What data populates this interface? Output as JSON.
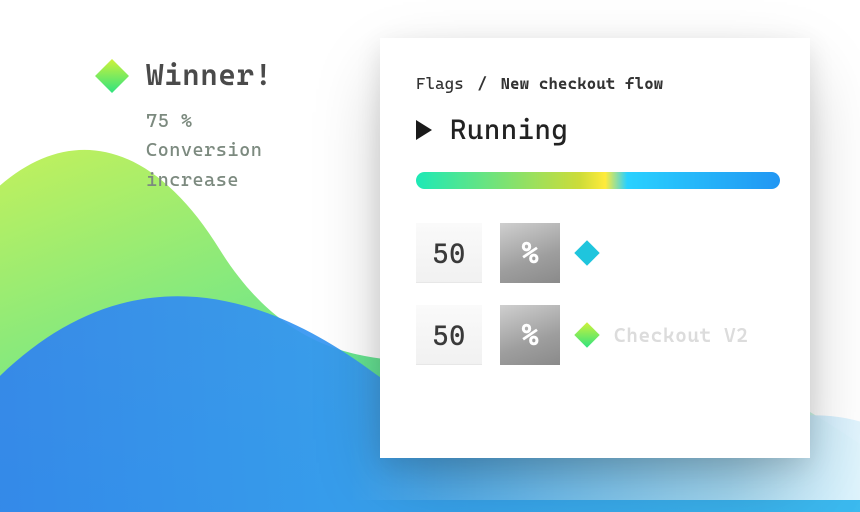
{
  "summary": {
    "title": "Winner!",
    "stat_line": "75 %",
    "metric_line1": "Conversion",
    "metric_line2": "increase"
  },
  "card": {
    "breadcrumb_root": "Flags",
    "breadcrumb_sep": "/",
    "breadcrumb_leaf": "New checkout flow",
    "status": "Running",
    "percent_symbol": "%",
    "variants": [
      {
        "value": "50",
        "marker": "teal",
        "label": ""
      },
      {
        "value": "50",
        "marker": "green",
        "label": "Checkout V2"
      }
    ]
  }
}
